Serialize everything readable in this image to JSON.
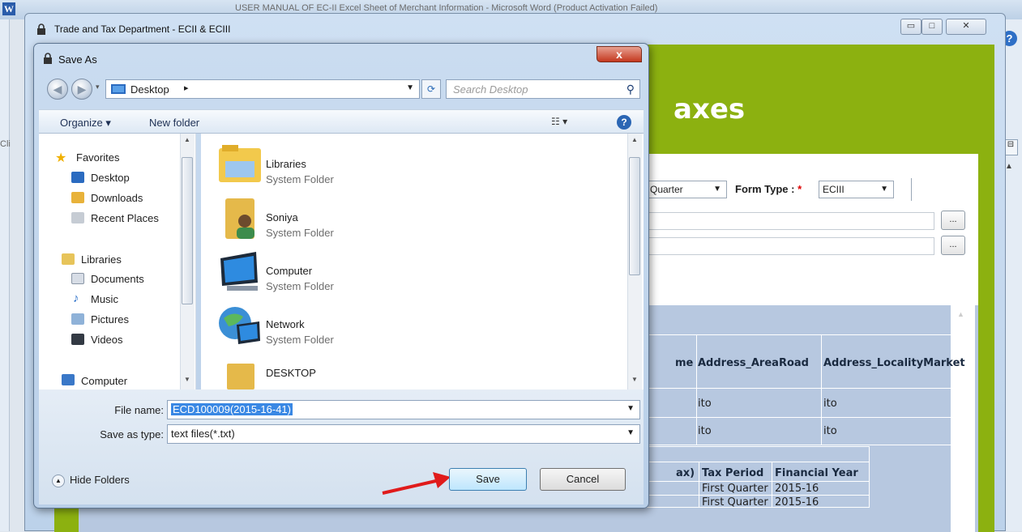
{
  "word": {
    "icon_letter": "W",
    "title": "USER MANUAL OF EC-II Excel Sheet of Merchant Information - Microsoft Word (Product Activation Failed)",
    "clip_label": "Cli",
    "help": "?"
  },
  "app_window": {
    "title": "Trade and Tax Department - ECII & ECIII",
    "minimize": "▭",
    "maximize": "□",
    "close": "✕",
    "heading_partial": "axes",
    "quarter_select": "Quarter",
    "form_type_label": "Form Type :",
    "required_mark": "*",
    "form_type_value": "ECIII",
    "browse_label": "...",
    "table": {
      "headers": [
        "me",
        "Address_AreaRoad",
        "Address_LocalityMarket"
      ],
      "rows": [
        [
          "",
          "ito",
          "ito"
        ],
        [
          "",
          "ito",
          "ito"
        ]
      ]
    },
    "summary_table": {
      "headers": [
        "ax)",
        "Tax Period",
        "Financial Year"
      ],
      "rows": [
        [
          "",
          "First Quarter",
          "2015-16"
        ],
        [
          "",
          "First Quarter",
          "2015-16"
        ]
      ]
    }
  },
  "dialog": {
    "title": "Save As",
    "close": "x",
    "location": "Desktop",
    "search_placeholder": "Search Desktop",
    "organize": "Organize ▾",
    "new_folder": "New folder",
    "help": "?",
    "nav": {
      "favorites": "Favorites",
      "fav_items": [
        "Desktop",
        "Downloads",
        "Recent Places"
      ],
      "libraries": "Libraries",
      "lib_items": [
        "Documents",
        "Music",
        "Pictures",
        "Videos"
      ],
      "computer": "Computer"
    },
    "files": [
      {
        "name": "Libraries",
        "type": "System Folder"
      },
      {
        "name": "Soniya",
        "type": "System Folder"
      },
      {
        "name": "Computer",
        "type": "System Folder"
      },
      {
        "name": "Network",
        "type": "System Folder"
      },
      {
        "name": "DESKTOP",
        "type": ""
      }
    ],
    "file_name_label": "File name:",
    "file_name_value": "ECD100009(2015-16-41)",
    "save_type_label": "Save as type:",
    "save_type_value": "text files(*.txt)",
    "hide_folders": "Hide Folders",
    "save": "Save",
    "cancel": "Cancel"
  },
  "colors": {
    "app_green": "#8cb110",
    "grid_blue": "#b7c8e0",
    "selection": "#3a88e4",
    "arrow_red": "#e01b1b"
  }
}
